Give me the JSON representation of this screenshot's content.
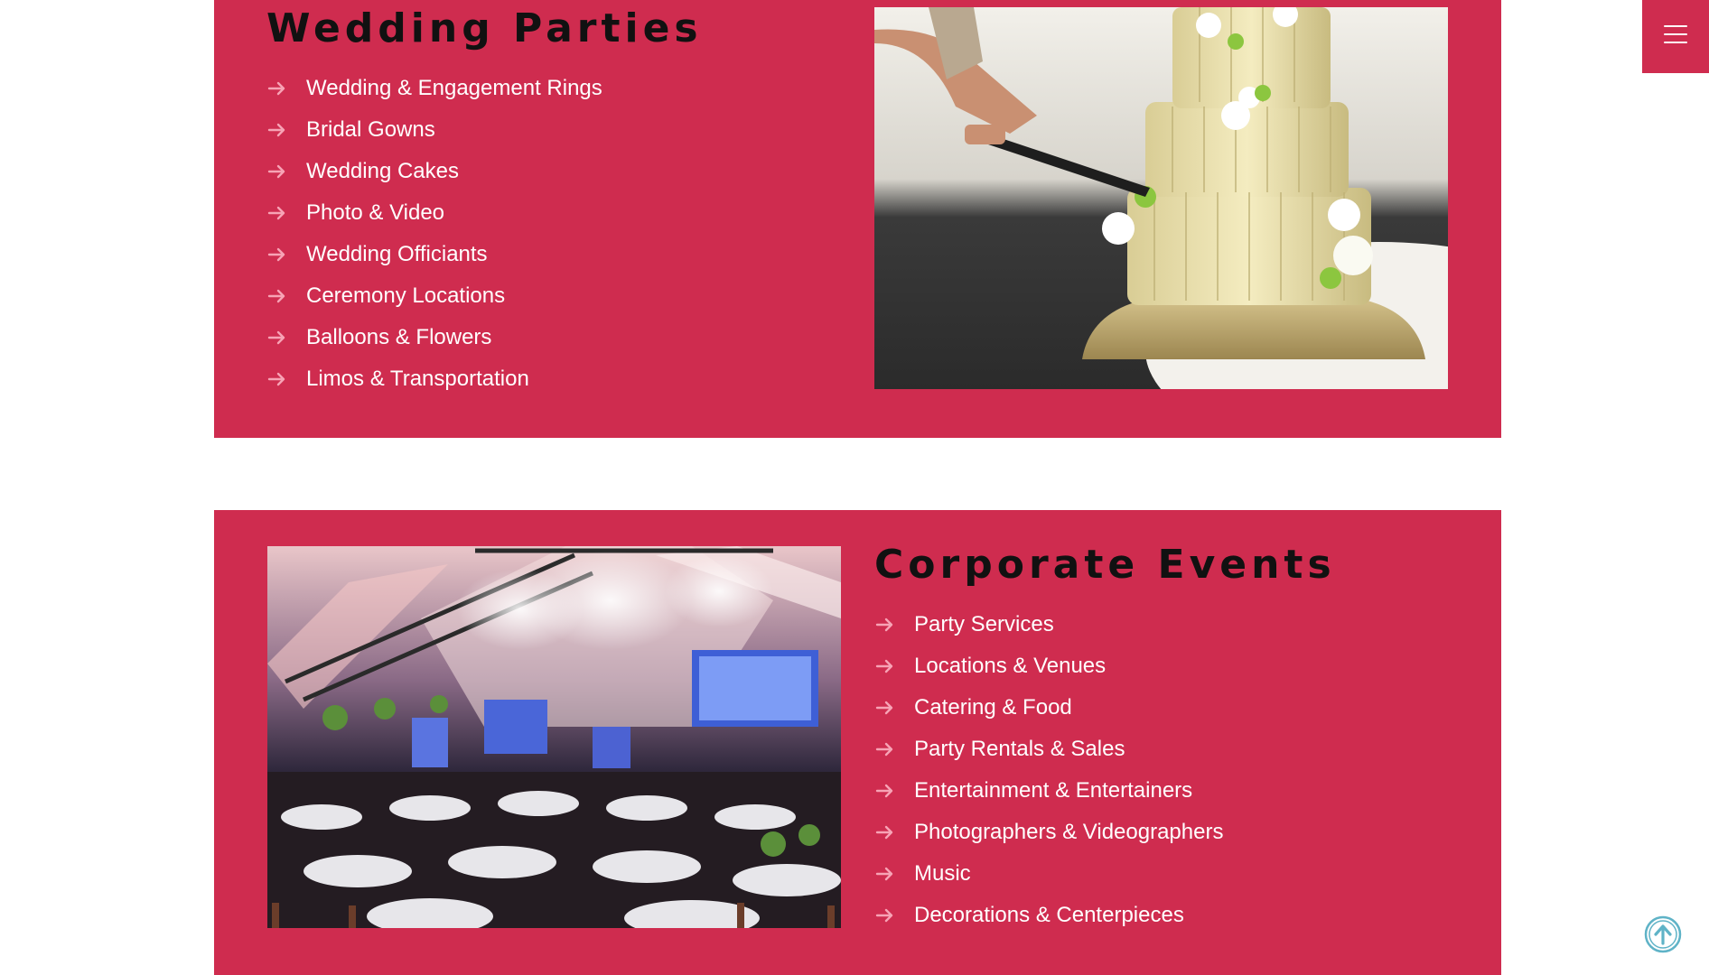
{
  "wedding": {
    "title": "Wedding Parties",
    "items": [
      "Wedding & Engagement Rings",
      "Bridal Gowns",
      "Wedding Cakes",
      "Photo & Video",
      "Wedding Officiants",
      "Ceremony Locations",
      "Balloons & Flowers",
      "Limos & Transportation"
    ]
  },
  "corporate": {
    "title": "Corporate Events",
    "items": [
      "Party Services",
      "Locations & Venues",
      "Catering & Food",
      "Party Rentals & Sales",
      "Entertainment & Entertainers",
      "Photographers & Videographers",
      "Music",
      "Decorations & Centerpieces"
    ]
  },
  "icons": {
    "list_bullet": "arrow-right-icon",
    "menu": "hamburger-menu-icon",
    "scroll_top": "arrow-up-circle-icon"
  },
  "colors": {
    "panel_background": "#cf2c4f",
    "title_text": "#111111",
    "item_text": "#ffffff",
    "bullet_arrow": "#f7a3b5",
    "scroll_top_accent": "#5fb3c7"
  }
}
